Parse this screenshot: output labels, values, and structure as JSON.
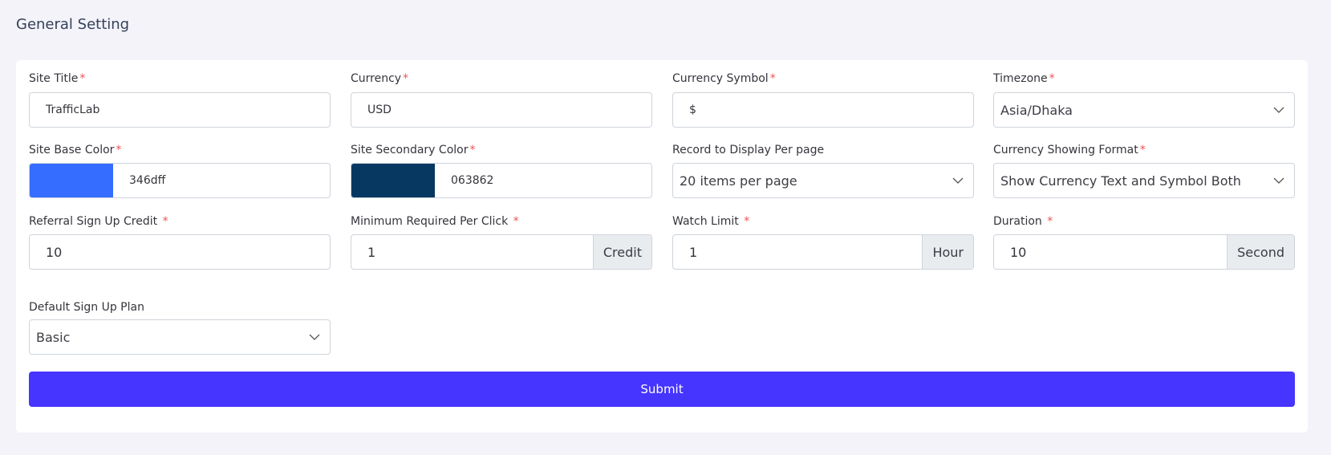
{
  "page": {
    "title": "General Setting"
  },
  "colors": {
    "accent": "#4634ff",
    "required": "#ea5455",
    "base_swatch": "#346dff",
    "secondary_swatch": "#063862"
  },
  "required_mark": "*",
  "fields": {
    "site_title": {
      "label": "Site Title",
      "value": "TrafficLab"
    },
    "currency": {
      "label": "Currency",
      "value": "USD"
    },
    "currency_symbol": {
      "label": "Currency Symbol",
      "value": "$"
    },
    "timezone": {
      "label": "Timezone",
      "value": "Asia/Dhaka"
    },
    "site_base_color": {
      "label": "Site Base Color",
      "value": "346dff"
    },
    "site_secondary_color": {
      "label": "Site Secondary Color",
      "value": "063862"
    },
    "records_per_page": {
      "label": "Record to Display Per page",
      "value": "20 items per page"
    },
    "currency_format": {
      "label": "Currency Showing Format",
      "value": "Show Currency Text and Symbol Both"
    },
    "referral_credit": {
      "label": "Referral Sign Up Credit",
      "value": "10"
    },
    "min_per_click": {
      "label": "Minimum Required Per Click",
      "value": "1",
      "addon": "Credit"
    },
    "watch_limit": {
      "label": "Watch Limit",
      "value": "1",
      "addon": "Hour"
    },
    "duration": {
      "label": "Duration",
      "value": "10",
      "addon": "Second"
    },
    "default_plan": {
      "label": "Default Sign Up Plan",
      "value": "Basic"
    }
  },
  "submit_label": "Submit"
}
